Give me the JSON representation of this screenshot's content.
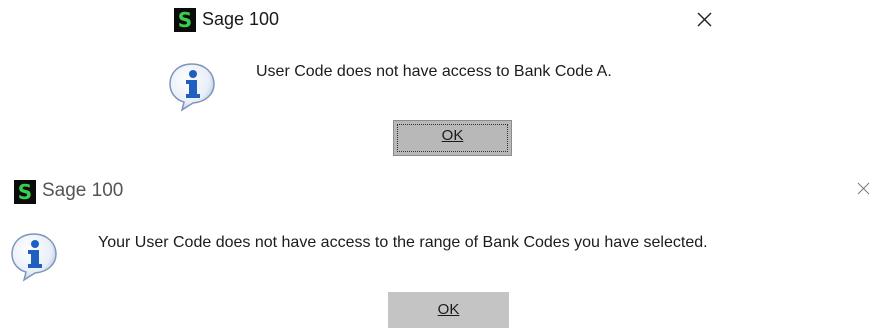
{
  "dialog_1": {
    "title": "Sage 100",
    "logo_glyph": "S",
    "message": "User Code does not have access to Bank Code A.",
    "ok_label": "OK",
    "icon": "info-icon"
  },
  "dialog_2": {
    "title": "Sage 100",
    "logo_glyph": "S",
    "message": "Your User Code does not have access to the range of Bank Codes you have selected.",
    "ok_label": "OK",
    "icon": "info-icon"
  },
  "colors": {
    "logo_bg": "#0b0b0b",
    "logo_fg": "#37d04a",
    "button_bg": "#b8b8b8",
    "info_blue": "#1e5fbf"
  }
}
